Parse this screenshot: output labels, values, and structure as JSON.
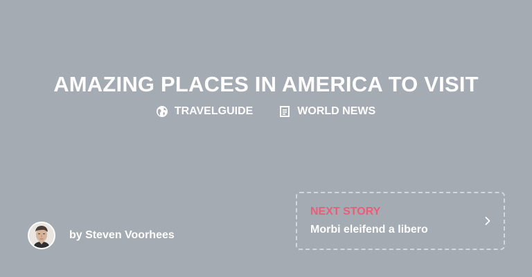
{
  "hero": {
    "title": "AMAZING PLACES IN AMERICA TO VISIT"
  },
  "meta": {
    "category": {
      "label": "TRAVELGUIDE",
      "icon": "globe-icon"
    },
    "section": {
      "label": "WORLD NEWS",
      "icon": "article-icon"
    }
  },
  "author": {
    "byline": "by Steven Voorhees"
  },
  "next_story": {
    "label": "NEXT STORY",
    "title": "Morbi eleifend a libero",
    "icon": "chevron-right-icon",
    "accent_color": "#ee5b76"
  },
  "colors": {
    "background": "#a5abb3",
    "text": "#ffffff"
  }
}
